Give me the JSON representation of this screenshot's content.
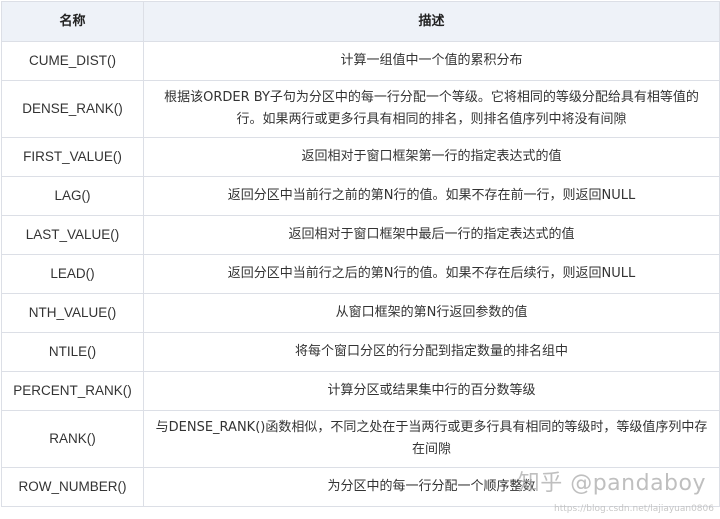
{
  "table": {
    "headers": [
      "名称",
      "描述"
    ],
    "rows": [
      {
        "name": "CUME_DIST()",
        "desc": "计算一组值中一个值的累积分布"
      },
      {
        "name": "DENSE_RANK()",
        "desc": "根据该ORDER BY子句为分区中的每一行分配一个等级。它将相同的等级分配给具有相等值的行。如果两行或更多行具有相同的排名，则排名值序列中将没有间隙"
      },
      {
        "name": "FIRST_VALUE()",
        "desc": "返回相对于窗口框架第一行的指定表达式的值"
      },
      {
        "name": "LAG()",
        "desc": "返回分区中当前行之前的第N行的值。如果不存在前一行，则返回NULL"
      },
      {
        "name": "LAST_VALUE()",
        "desc": "返回相对于窗口框架中最后一行的指定表达式的值"
      },
      {
        "name": "LEAD()",
        "desc": "返回分区中当前行之后的第N行的值。如果不存在后续行，则返回NULL"
      },
      {
        "name": "NTH_VALUE()",
        "desc": "从窗口框架的第N行返回参数的值"
      },
      {
        "name": "NTILE()",
        "desc": "将每个窗口分区的行分配到指定数量的排名组中"
      },
      {
        "name": "PERCENT_RANK()",
        "desc": "计算分区或结果集中行的百分数等级"
      },
      {
        "name": "RANK()",
        "desc": "与DENSE_RANK()函数相似，不同之处在于当两行或更多行具有相同的等级时，等级值序列中存在间隙"
      },
      {
        "name": "ROW_NUMBER()",
        "desc": "为分区中的每一行分配一个顺序整数"
      }
    ]
  },
  "watermark": {
    "text": "知乎 @pandaboy",
    "url": "https://blog.csdn.net/lajiayuan0806"
  }
}
